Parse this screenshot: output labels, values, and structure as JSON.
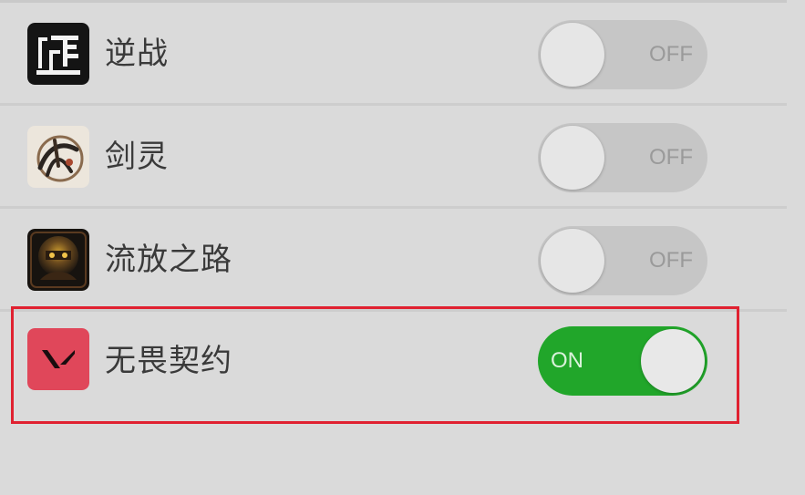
{
  "apps": [
    {
      "name": "逆战",
      "toggle_state": "OFF",
      "enabled": false,
      "icon": "nizhan-app-icon"
    },
    {
      "name": "剑灵",
      "toggle_state": "OFF",
      "enabled": false,
      "icon": "jianling-app-icon"
    },
    {
      "name": "流放之路",
      "toggle_state": "OFF",
      "enabled": false,
      "icon": "path-of-exile-app-icon"
    },
    {
      "name": "无畏契约",
      "toggle_state": "ON",
      "enabled": true,
      "icon": "valorant-app-icon"
    }
  ],
  "colors": {
    "background": "#dadada",
    "toggle_off": "#c6c6c6",
    "toggle_on": "#21a62a",
    "highlight_border": "#e02130",
    "valorant_red": "#e0475a"
  },
  "highlighted_app": "无畏契约"
}
